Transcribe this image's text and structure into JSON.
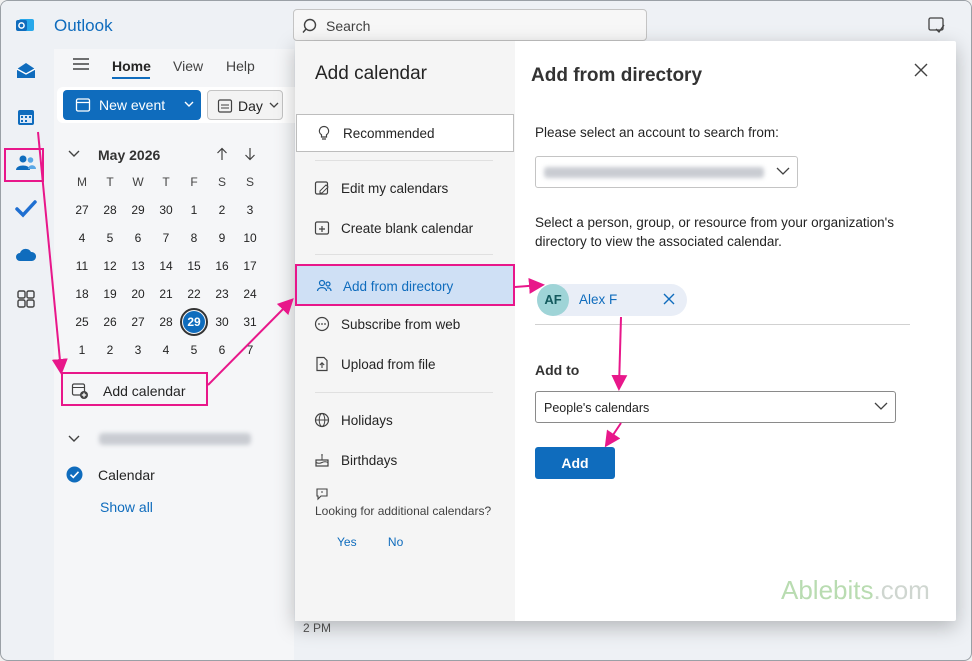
{
  "app": {
    "title": "Outlook"
  },
  "search": {
    "placeholder": "Search"
  },
  "tabs": [
    {
      "label": "Home"
    },
    {
      "label": "View"
    },
    {
      "label": "Help"
    }
  ],
  "ribbon": {
    "new_event": "New event",
    "day": "Day"
  },
  "mini_calendar": {
    "title": "May 2026",
    "weekdays": [
      "M",
      "T",
      "W",
      "T",
      "F",
      "S",
      "S"
    ],
    "weeks": [
      [
        "27",
        "28",
        "29",
        "30",
        "1",
        "2",
        "3"
      ],
      [
        "4",
        "5",
        "6",
        "7",
        "8",
        "9",
        "10"
      ],
      [
        "11",
        "12",
        "13",
        "14",
        "15",
        "16",
        "17"
      ],
      [
        "18",
        "19",
        "20",
        "21",
        "22",
        "23",
        "24"
      ],
      [
        "25",
        "26",
        "27",
        "28",
        "29",
        "30",
        "31"
      ],
      [
        "1",
        "2",
        "3",
        "4",
        "5",
        "6",
        "7"
      ]
    ],
    "today": "29"
  },
  "sidebar": {
    "add_calendar": "Add calendar",
    "calendar_item": "Calendar",
    "show_all": "Show all"
  },
  "timeline": {
    "time_label": "2 PM"
  },
  "dialog": {
    "title": "Add calendar",
    "nav": [
      {
        "label": "Recommended",
        "icon": "lightbulb-icon"
      },
      {
        "label": "Edit my calendars",
        "icon": "edit-calendar-icon"
      },
      {
        "label": "Create blank calendar",
        "icon": "add-calendar-icon"
      },
      {
        "label": "Add from directory",
        "icon": "people-directory-icon"
      },
      {
        "label": "Subscribe from web",
        "icon": "web-icon"
      },
      {
        "label": "Upload from file",
        "icon": "file-upload-icon"
      },
      {
        "label": "Holidays",
        "icon": "globe-icon"
      },
      {
        "label": "Birthdays",
        "icon": "cake-icon"
      }
    ],
    "feedback_question": "Looking for additional calendars?",
    "feedback_yes": "Yes",
    "feedback_no": "No",
    "pane_title": "Add from directory",
    "account_label": "Please select an account to search from:",
    "description": "Select a person, group, or resource from your organization's directory to view the associated calendar.",
    "person_initials": "AF",
    "person_name": "Alex F",
    "add_to_label": "Add to",
    "add_to_value": "People's calendars",
    "add_button": "Add"
  },
  "watermark": {
    "brand": "Ablebits",
    "domain": ".com"
  },
  "colors": {
    "accent": "#0f6cbd",
    "highlight": "#e8178a"
  }
}
